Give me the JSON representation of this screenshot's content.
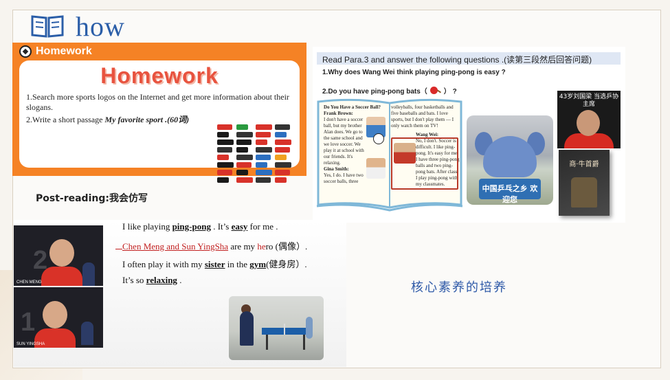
{
  "slide": {
    "title": "how",
    "title_icon": "open-book-icon",
    "accent": "#2b5ea8"
  },
  "homework": {
    "header": "Homework",
    "big_title": "Homework",
    "task1": "1.Search more sports logos on the Internet and get more information about their slogans.",
    "task2_prefix": "2.Write a short passage ",
    "task2_emph": "My favorite sport .(60词)",
    "panel_color": "#f58225",
    "logo_colors": [
      "#d8322a",
      "#2a9a3f",
      "#d8322a",
      "#333333",
      "#1a1a1a",
      "#333333",
      "#d8322a",
      "#2c6fc0",
      "#1a1a1a",
      "#1a1a1a",
      "#d8322a",
      "#d8322a",
      "#333333",
      "#1a1a1a",
      "#333333",
      "#d8322a",
      "#d8322a",
      "#333333",
      "#2c6fc0",
      "#f0a020",
      "#1a1a1a",
      "#d8322a",
      "#2c6fc0",
      "#333333",
      "#d8322a",
      "#1a1a1a",
      "#2c6fc0",
      "#d8322a",
      "#1a1a1a",
      "#d8322a",
      "#333333",
      "#d8322a"
    ]
  },
  "reading": {
    "instruction": "Read Para.3 and answer the following questions  .(读第三段然后回答问题)",
    "q1": "1.Why does Wang Wei think playing ping-pong is easy ?",
    "q2_prefix": "2.Do you have ping-pong bats（",
    "q2_suffix": "）  ?",
    "book": {
      "heading": "Do You Have a Soccer Ball?",
      "frank_name": "Frank Brown:",
      "frank_text": "I don't have a soccer ball, but my brother Alan does. We go to the same school and we love soccer. We play it at school with our friends. It's relaxing.",
      "gina_name": "Gina Smith:",
      "gina_text": "Yes, I do. I have two soccer balls, three",
      "right_top": "volleyballs, four basketballs and five baseballs and bats. I love sports, but I don't play them — I only watch them on TV!",
      "wangwei_name": "Wang Wei:",
      "wangwei_text": "No, I don't. Soccer is difficult. I like ping-pong. It's easy for me. I have three ping-pong balls and two ping-pong bats. After class, I play ping-pong with my classmates."
    },
    "mascot_sign": "中国乒乓之乡 欢迎您",
    "portrait_caption": "43岁刘国梁 当选乒协主席",
    "book_cover_title": "商·牛首爵"
  },
  "post_reading": {
    "title": "Post-reading:我会仿写",
    "s1_a": "I like playing ",
    "s1_b": "ping-pong",
    "s1_c": " . It’s ",
    "s1_d": "easy",
    "s1_e": " for me .",
    "s2_a": "Chen Meng and Sun YingSha",
    "s2_b": " are my ",
    "s2_c": "he",
    "s2_d": "ro (偶像）.",
    "s3_a": "I often play it with my ",
    "s3_b": "sister",
    "s3_c": " in the ",
    "s3_d": "gym",
    "s3_e": "(健身房）.",
    "s4_a": "It’s so ",
    "s4_b": "relaxing",
    "s4_c": " .",
    "player1_name": "CHEN MENG",
    "player1_num": "2",
    "player2_name": "SUN YINGSHA",
    "player2_num": "1"
  },
  "core_text": "核心素养的培养"
}
